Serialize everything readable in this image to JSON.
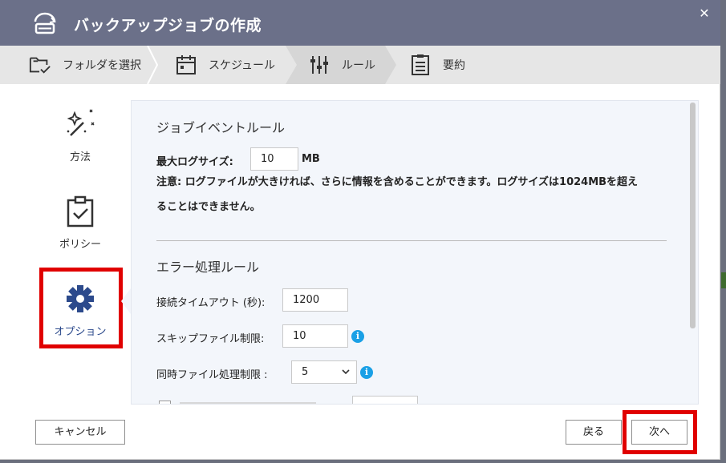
{
  "window": {
    "title": "バックアップジョブの作成",
    "close_symbol": "✕",
    "title_icon": "backup-drive-icon"
  },
  "steps": [
    {
      "label": "フォルダを選択",
      "icon": "folder-check-icon"
    },
    {
      "label": "スケジュール",
      "icon": "calendar-icon"
    },
    {
      "label": "ルール",
      "icon": "sliders-icon",
      "active": true
    },
    {
      "label": "要約",
      "icon": "clipboard-list-icon"
    }
  ],
  "nav": {
    "method": "方法",
    "policy": "ポリシー",
    "options": "オプション"
  },
  "job_event_rules": {
    "title": "ジョブイベントルール",
    "max_log_label": "最大ログサイズ:",
    "max_log_value": "10",
    "max_log_unit": "MB",
    "note_line1": "注意: ログファイルが大きければ、さらに情報を含めることができます。ログサイズは1024MBを超え",
    "note_line2": "ることはできません。"
  },
  "error_rules": {
    "title": "エラー処理ルール",
    "timeout_label": "接続タイムアウト (秒):",
    "timeout_value": "1200",
    "skip_label": "スキップファイル制限:",
    "skip_value": "10",
    "concurrent_label": "同時ファイル処理制限 :",
    "concurrent_value": "5"
  },
  "footer": {
    "cancel": "キャンセル",
    "back": "戻る",
    "next": "次へ"
  },
  "colors": {
    "titlebar": "#6b7089",
    "highlight": "#e00000",
    "accent": "#2c4a8c",
    "info": "#1aa0e6"
  }
}
